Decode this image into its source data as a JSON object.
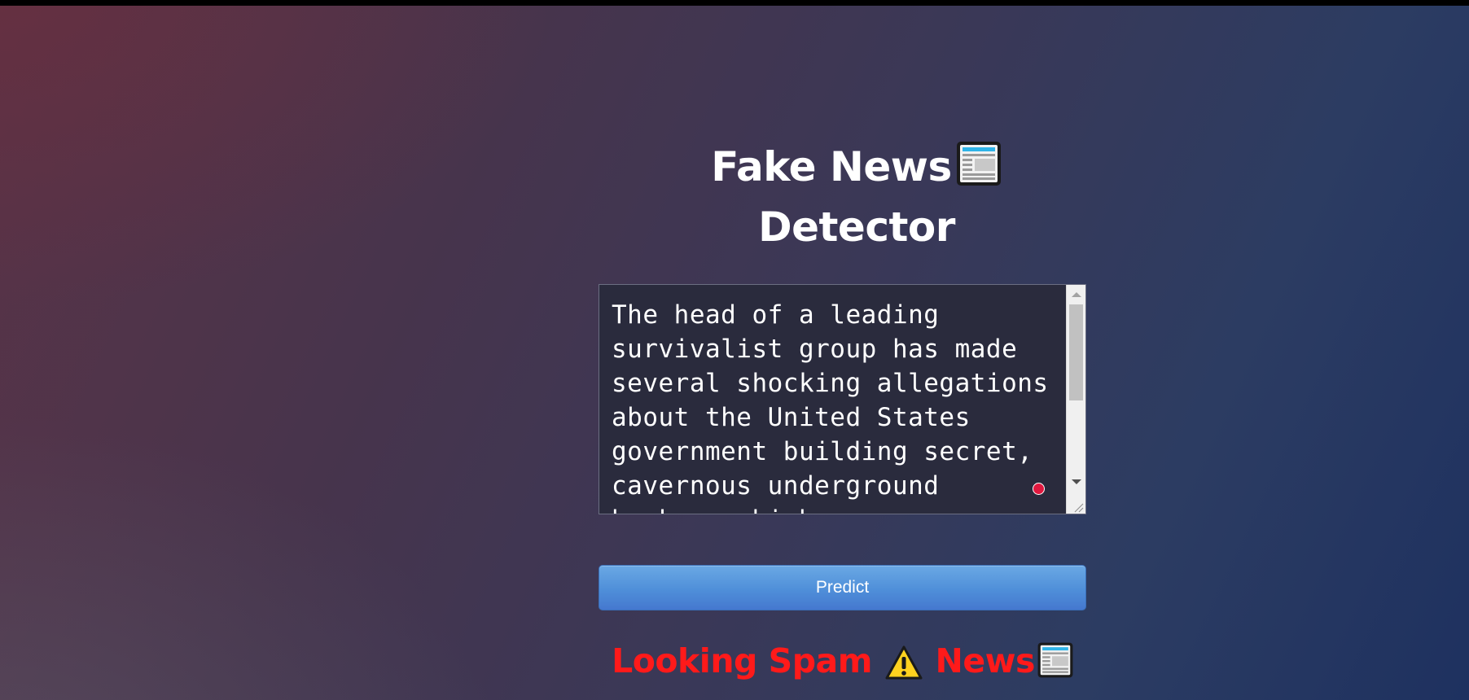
{
  "page": {
    "title_line1": "Fake News",
    "title_line2": "Detector",
    "title_icon": "newspaper-icon"
  },
  "input": {
    "text": "The head of a leading survivalist group has made several shocking allegations about the United States government building secret, cavernous underground bunkers which"
  },
  "predict_button": {
    "label": "Predict"
  },
  "result": {
    "part1": "Looking Spam",
    "warning_icon": "warning-icon",
    "part2": "News",
    "news_icon": "newspaper-icon",
    "color": "#ff1a1a"
  },
  "colors": {
    "button_accent": "#4f8fd9",
    "indicator_dot": "#e0183f"
  }
}
